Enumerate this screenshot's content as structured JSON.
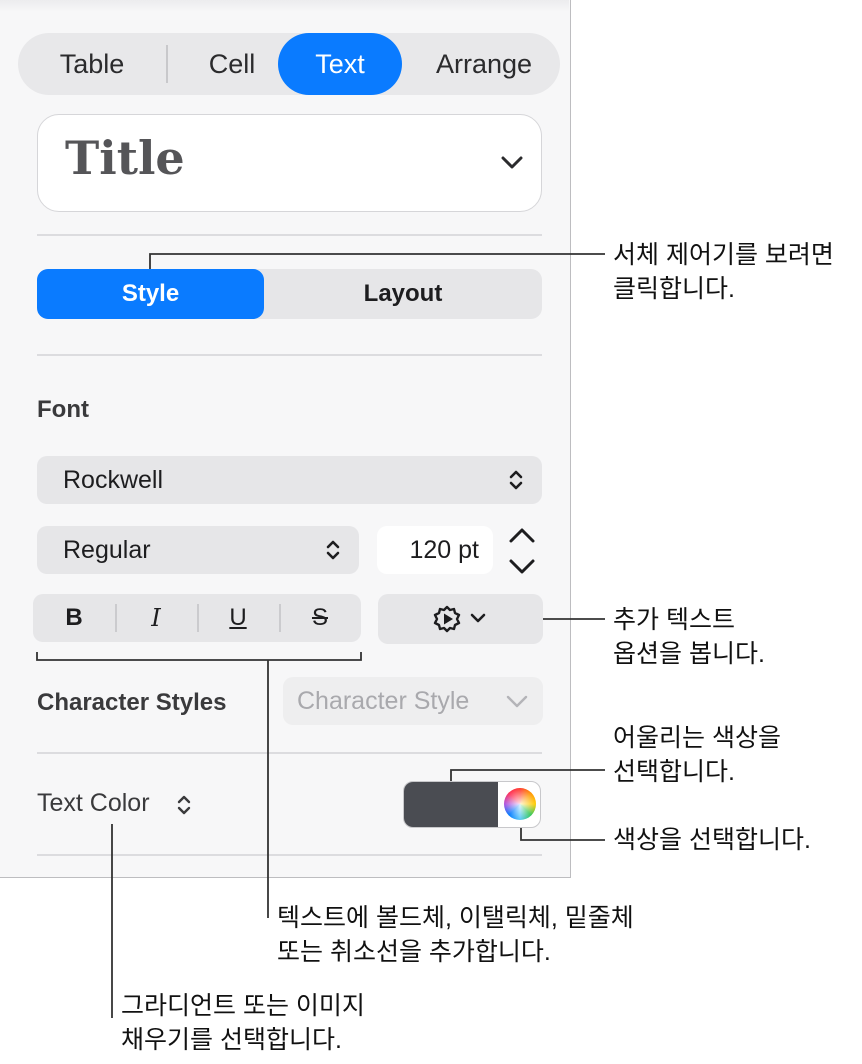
{
  "tabs": [
    {
      "label": "Table",
      "active": false
    },
    {
      "label": "Cell",
      "active": false
    },
    {
      "label": "Text",
      "active": true
    },
    {
      "label": "Arrange",
      "active": false
    }
  ],
  "paragraph_style": {
    "value": "Title",
    "icon": "chevron-down-icon"
  },
  "subtabs": [
    {
      "label": "Style",
      "active": true
    },
    {
      "label": "Layout",
      "active": false
    }
  ],
  "font": {
    "section_label": "Font",
    "family": "Rockwell",
    "typeface": "Regular",
    "size": "120 pt"
  },
  "format_buttons": {
    "bold": "B",
    "italic": "I",
    "underline": "U",
    "strikethrough": "S"
  },
  "advanced_options_icon": "gear-icon",
  "character_styles": {
    "label": "Character Styles",
    "value": "Character Style"
  },
  "text_color": {
    "label": "Text Color",
    "swatch_color": "#4a4c52"
  },
  "accent_color": "#0a7bff",
  "callouts": {
    "style_tab": [
      "서체 제어기를 보려면",
      "클릭합니다."
    ],
    "more_options": [
      "추가 텍스트",
      "옵션을 봅니다."
    ],
    "matching_colors": [
      "어울리는 색상을",
      "선택합니다."
    ],
    "color_wheel": [
      "색상을 선택합니다."
    ],
    "bius": [
      "텍스트에 볼드체, 이탤릭체, 밑줄체",
      "또는 취소선을 추가합니다."
    ],
    "fill": [
      "그라디언트 또는 이미지",
      "채우기를 선택합니다."
    ]
  }
}
